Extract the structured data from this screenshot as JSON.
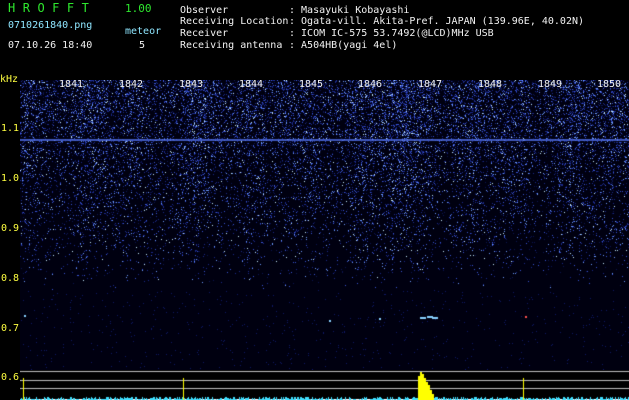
{
  "header": {
    "app_title": "HROFFT",
    "app_version": "1.00",
    "file_name": "0710261840.png",
    "meteor_label": "meteor",
    "date_time": "07.10.26 18:40",
    "meteor_count": "5"
  },
  "metadata": [
    {
      "key": "Observer",
      "value": ": Masayuki Kobayashi"
    },
    {
      "key": "Receiving Location",
      "value": ": Ogata-vill. Akita-Pref. JAPAN (139.96E, 40.02N)"
    },
    {
      "key": "Receiver",
      "value": ": ICOM IC-575 53.7492(@LCD)MHz USB"
    },
    {
      "key": "Receiving antenna",
      "value": ": A504HB(yagi 4el)"
    }
  ],
  "axis": {
    "unit": "kHz",
    "y_ticks": [
      "1.1",
      "1.0",
      "0.9",
      "0.8",
      "0.7",
      "0.6"
    ],
    "x_ticks": [
      "1841",
      "1842",
      "1843",
      "1844",
      "1845",
      "1846",
      "1847",
      "1848",
      "1849",
      "1850"
    ]
  },
  "colors": {
    "background": "#000000",
    "header_text": "#2ee82e",
    "label_text": "#f2f2f2",
    "tick_text": "#ffff40",
    "signal_low": "#1a2a8a",
    "signal_high": "#a8e0ff",
    "carrier_line": "#3a5ac8",
    "meteor_spike": "#ffff00"
  }
}
